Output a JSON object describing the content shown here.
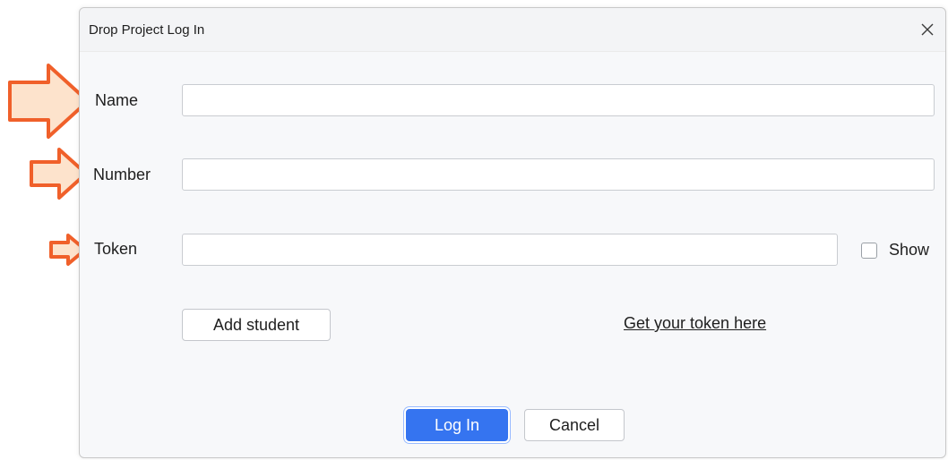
{
  "dialog": {
    "title": "Drop Project Log In",
    "close_glyph": "×"
  },
  "form": {
    "name_label": "Name",
    "name_value": "",
    "number_label": "Number",
    "number_value": "",
    "token_label": "Token",
    "token_value": "",
    "show_label": "Show",
    "show_checked": false
  },
  "actions": {
    "add_student_label": "Add student",
    "token_link_label": "Get your token here",
    "login_label": "Log In",
    "cancel_label": "Cancel"
  },
  "annotations": {
    "arrow_fill": "#fde3cc",
    "arrow_stroke": "#f0602a",
    "arrow_icon": "right-arrow-icon"
  },
  "theme": {
    "accent": "#3574f0"
  }
}
